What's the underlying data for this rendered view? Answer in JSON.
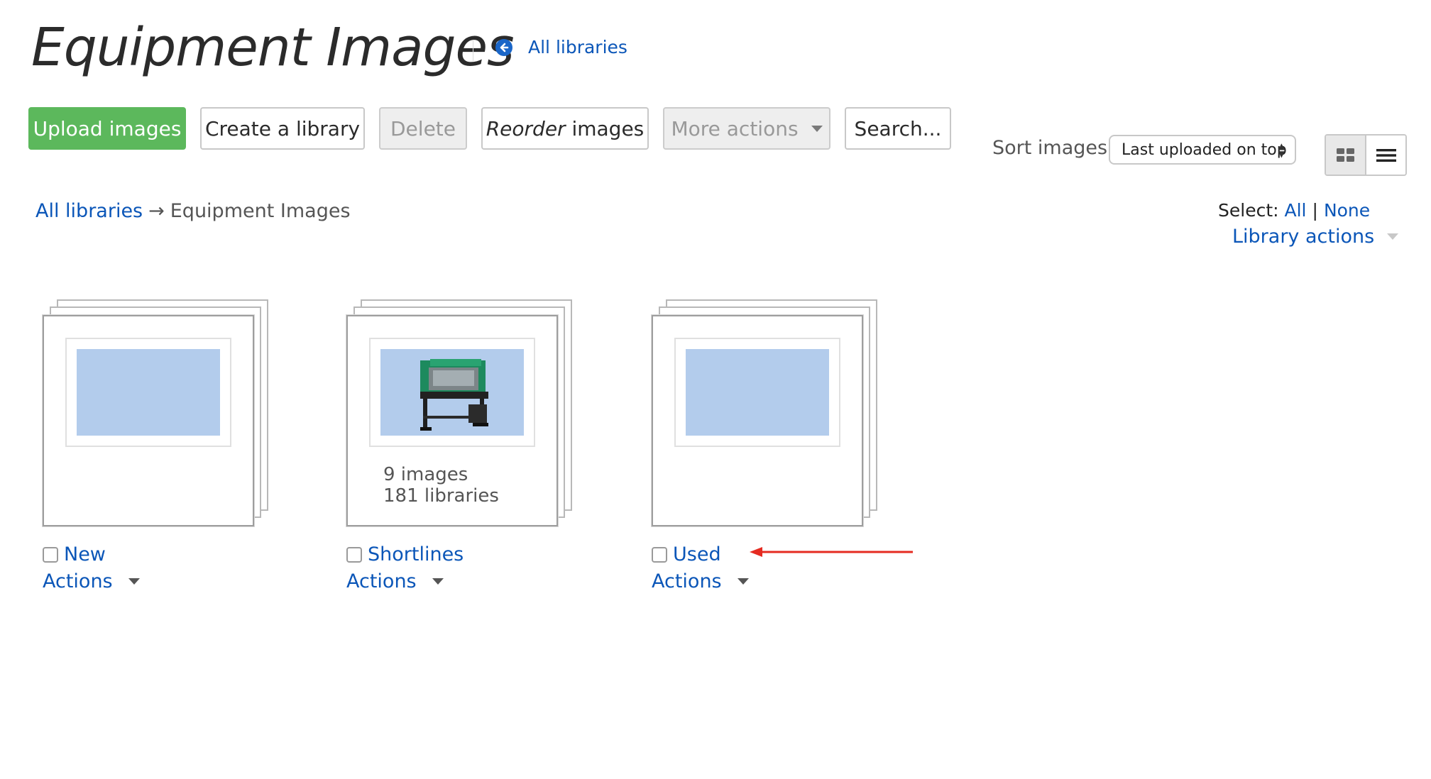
{
  "page": {
    "title": "Equipment Images",
    "back_link": "All libraries"
  },
  "toolbar": {
    "upload": "Upload images",
    "create_library": "Create a library",
    "delete": "Delete",
    "reorder_em": "Reorder",
    "reorder_rest": " images",
    "more_actions": "More actions",
    "search": "Search..."
  },
  "sort": {
    "label": "Sort images",
    "selected": "Last uploaded on top"
  },
  "breadcrumb": {
    "root": "All libraries",
    "arrow": "→",
    "current": "Equipment Images"
  },
  "selection": {
    "label": "Select:",
    "all": "All",
    "divider": "|",
    "none": "None",
    "library_actions": "Library actions"
  },
  "libraries": [
    {
      "name": "New",
      "actions": "Actions",
      "has_image": false
    },
    {
      "name": "Shortlines",
      "actions": "Actions",
      "has_image": true,
      "image_count": "9 images",
      "library_count": "181 libraries"
    },
    {
      "name": "Used",
      "actions": "Actions",
      "has_image": false
    }
  ],
  "colors": {
    "primary_green": "#5cb85c",
    "link_blue": "#0b56b8",
    "thumb_placeholder": "#b3ccec",
    "annotation_red": "#e52b21"
  }
}
